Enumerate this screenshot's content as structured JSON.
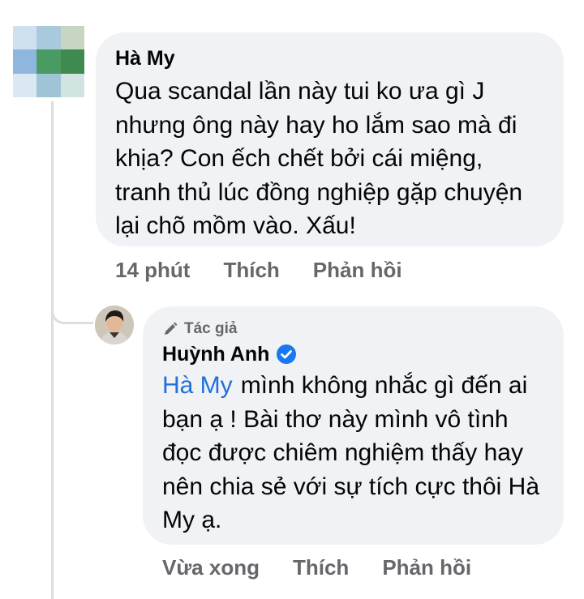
{
  "comment": {
    "author": "Hà My",
    "text": "Qua scandal lần này tui ko ưa gì J nhưng ông này hay ho lắm sao mà đi khịa? Con ếch chết bởi cái miệng, tranh thủ lúc đồng nghiệp gặp chuyện lại chõ mồm vào. Xấu!",
    "time": "14 phút",
    "like_label": "Thích",
    "reply_label": "Phản hồi",
    "avatar_colors": [
      "#cfe0ee",
      "#a9c9dc",
      "#c6d6c2",
      "#8fb6de",
      "#4a9a64",
      "#3f8a4f",
      "#dbe7f2",
      "#9fc4d6",
      "#d2e4e2"
    ]
  },
  "reply": {
    "badge": "Tác giả",
    "author": "Huỳnh Anh",
    "mention": "Hà My",
    "text": "mình không nhắc gì đến ai bạn ạ ! Bài thơ này mình vô tình đọc được chiêm nghiệm thấy hay nên chia sẻ với sự tích cực thôi Hà My ạ.",
    "time": "Vừa xong",
    "like_label": "Thích",
    "reply_label": "Phản hồi",
    "verified_color": "#1877f2"
  }
}
